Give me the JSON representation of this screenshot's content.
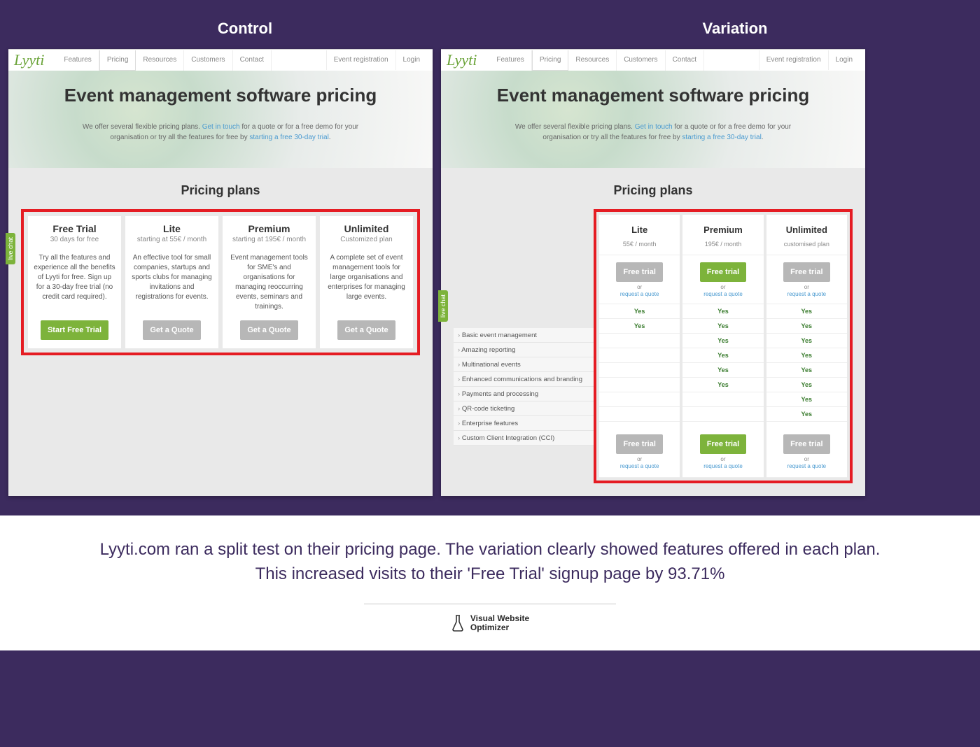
{
  "labels": {
    "control": "Control",
    "variation": "Variation"
  },
  "nav": {
    "logo": "Lyyti",
    "main": [
      "Features",
      "Pricing",
      "Resources",
      "Customers",
      "Contact"
    ],
    "active": "Pricing",
    "right": [
      "Event registration",
      "Login"
    ]
  },
  "hero": {
    "title": "Event management software pricing",
    "p1a": "We offer several flexible pricing plans. ",
    "link1": "Get in touch",
    "p1b": " for a quote or for a free demo for your",
    "p2a": "organisation or try all the features for free by ",
    "link2": "starting a free 30-day trial",
    "p2b": "."
  },
  "section": "Pricing plans",
  "chat": "live chat",
  "common": {
    "yes": "Yes",
    "or": "or",
    "request": "request a quote"
  },
  "control": {
    "plans": [
      {
        "name": "Free Trial",
        "sub": "30 days for free",
        "desc": "Try all the features and experience all the benefits of Lyyti for free. Sign up for a 30-day free trial (no credit card required).",
        "btn": "Start Free Trial",
        "green": true
      },
      {
        "name": "Lite",
        "sub": "starting at 55€ / month",
        "desc": "An effective tool for small companies, startups and sports clubs for managing invitations and registrations for events.",
        "btn": "Get a Quote"
      },
      {
        "name": "Premium",
        "sub": "starting at 195€ / month",
        "desc": "Event management tools for SME's and organisations for managing reoccurring events, seminars and trainings.",
        "btn": "Get a Quote"
      },
      {
        "name": "Unlimited",
        "sub": "Customized plan",
        "desc": "A complete set of event management tools for large organisations and enterprises for managing large events.",
        "btn": "Get a Quote"
      }
    ]
  },
  "variation": {
    "features": [
      "Basic event management",
      "Amazing reporting",
      "Multinational events",
      "Enhanced communications and branding",
      "Payments and processing",
      "QR-code ticketing",
      "Enterprise features",
      "Custom Client Integration (CCI)"
    ],
    "plans": [
      {
        "name": "Lite",
        "price": "55€ / month",
        "btn": "Free trial",
        "green": false,
        "yes": [
          true,
          true,
          false,
          false,
          false,
          false,
          false,
          false
        ]
      },
      {
        "name": "Premium",
        "price": "195€ / month",
        "btn": "Free trial",
        "green": true,
        "yes": [
          true,
          true,
          true,
          true,
          true,
          true,
          false,
          false
        ]
      },
      {
        "name": "Unlimited",
        "price": "customised plan",
        "btn": "Free trial",
        "green": false,
        "yes": [
          true,
          true,
          true,
          true,
          true,
          true,
          true,
          true
        ]
      }
    ]
  },
  "bottom": {
    "line1": "Lyyti.com ran a split test on their pricing page. The variation clearly showed features offered in each plan.",
    "line2": "This increased visits to their 'Free Trial' signup page by 93.71%",
    "brand1": "Visual Website",
    "brand2": "Optimizer"
  }
}
